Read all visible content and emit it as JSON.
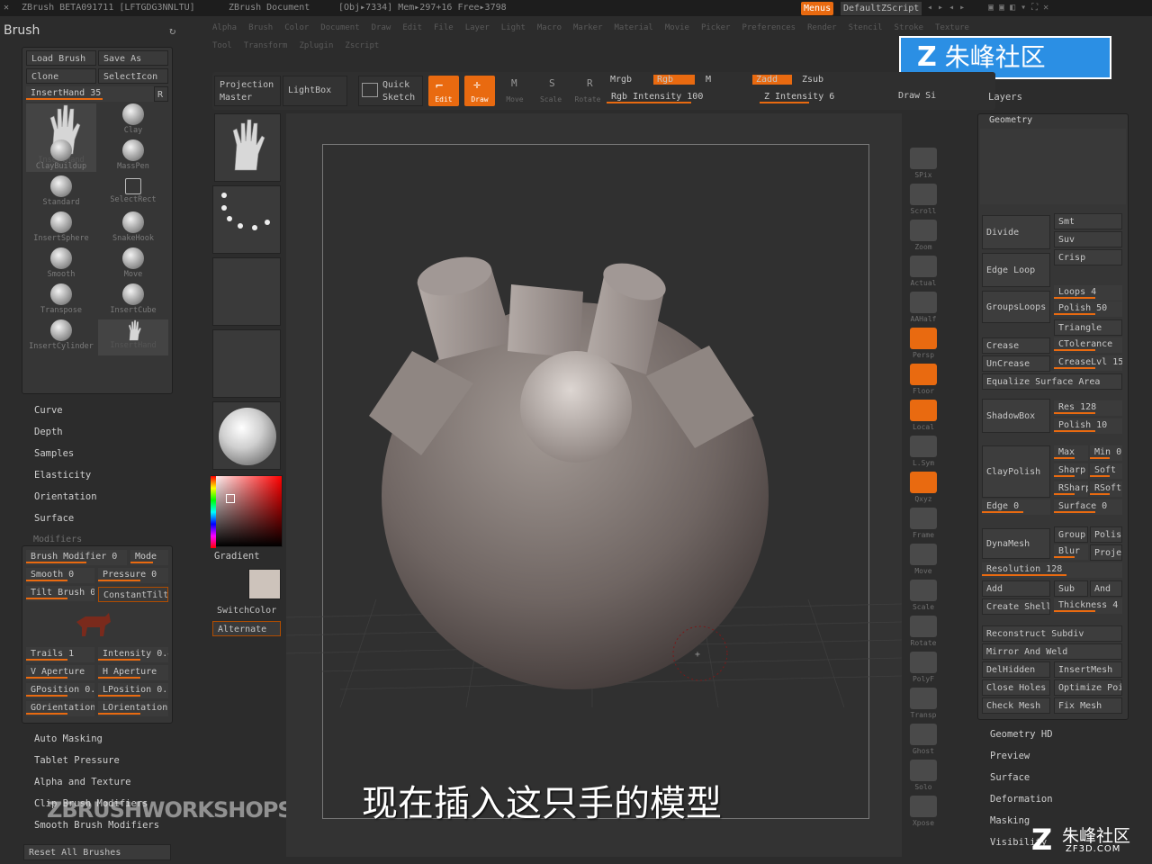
{
  "window": {
    "title": "ZBrush BETA091711 [LFTGDG3NNLTU]",
    "document": "ZBrush Document",
    "stats": "[Obj▸7334] Mem▸297+16 Free▸3798",
    "menus_btn": "Menus",
    "script_btn": "DefaultZScript"
  },
  "menubar": {
    "row1": [
      "Alpha",
      "Brush",
      "Color",
      "Document",
      "Draw",
      "Edit",
      "File",
      "Layer",
      "Light",
      "Macro",
      "Marker",
      "Material",
      "Movie",
      "Picker",
      "Preferences",
      "Render",
      "Stencil",
      "Stroke",
      "Texture"
    ],
    "row2": [
      "Tool",
      "Transform",
      "Zplugin",
      "Zscript"
    ]
  },
  "watermark": {
    "top_text": "朱峰社区",
    "bottom_text": "朱峰社区",
    "bottom_url": "ZF3D.COM",
    "workshops": "ZBRUSHWORKSHOPS"
  },
  "subtitle": "现在插入这只手的模型",
  "brush_panel": {
    "title": "Brush",
    "load": "Load Brush",
    "save": "Save As",
    "clone": "Clone",
    "selecticon": "SelectIcon",
    "current": "InsertHand 35",
    "r_btn": "R",
    "tiles": [
      {
        "label": "InsertHand",
        "shape": "hand"
      },
      {
        "label": "Clay",
        "shape": "sphere"
      },
      {
        "label": "ClayBuildup",
        "shape": "sphere"
      },
      {
        "label": "MassPen",
        "shape": "sphere"
      },
      {
        "label": "Standard",
        "shape": "sphere"
      },
      {
        "label": "SelectRect",
        "shape": "square"
      },
      {
        "label": "InsertSphere",
        "shape": "sphere"
      },
      {
        "label": "SnakeHook",
        "shape": "sphere"
      },
      {
        "label": "Smooth",
        "shape": "sphere"
      },
      {
        "label": "Move",
        "shape": "sphere"
      },
      {
        "label": "Transpose",
        "shape": "sphere"
      },
      {
        "label": "InsertCube",
        "shape": "sphere"
      },
      {
        "label": "InsertCylinder",
        "shape": "sphere"
      },
      {
        "label": "InsertHand",
        "shape": "hand"
      }
    ],
    "sections": [
      "Curve",
      "Depth",
      "Samples",
      "Elasticity",
      "Orientation",
      "Surface"
    ],
    "modifiers_title": "Modifiers",
    "modifiers": {
      "brush_modifier": "Brush Modifier 0",
      "mode": "Mode",
      "smooth": "Smooth 0",
      "pressure": "Pressure 0",
      "tilt": "Tilt Brush 0",
      "constant_tilt": "ConstantTilt",
      "trails": "Trails 1",
      "intensity": "Intensity 0.4",
      "v_aperture": "V Aperture",
      "h_aperture": "H Aperture",
      "gposition": "GPosition 0.2",
      "lposition": "LPosition 0.2",
      "gorientation": "GOrientation",
      "lorientation": "LOrientation"
    },
    "sections2": [
      "Auto Masking",
      "Tablet Pressure",
      "Alpha and Texture",
      "Clip Brush Modifiers",
      "Smooth Brush Modifiers"
    ],
    "reset": "Reset All Brushes"
  },
  "toolbar": {
    "projection_master": "Projection Master",
    "lightbox": "LightBox",
    "quick_sketch": "Quick Sketch",
    "edit": "Edit",
    "draw": "Draw",
    "move": "Move",
    "scale": "Scale",
    "rotate": "Rotate",
    "mrgb": "Mrgb",
    "rgb": "Rgb",
    "m": "M",
    "rgb_intensity": "Rgb Intensity 100",
    "zadd": "Zadd",
    "zsub": "Zsub",
    "z_intensity": "Z Intensity 6",
    "draw_size": "Draw Si"
  },
  "left_shelf": {
    "gradient": "Gradient",
    "switchcolor": "SwitchColor",
    "alternate": "Alternate"
  },
  "right_tools": [
    "SPix",
    "Scroll",
    "Zoom",
    "Actual",
    "AAHalf",
    "Persp",
    "Floor",
    "Local",
    "L.Sym",
    "Qxyz",
    "Frame",
    "Move",
    "Scale",
    "Rotate",
    "PolyF",
    "Transp",
    "Ghost",
    "Solo",
    "Xpose"
  ],
  "right_panel": {
    "layers": "Layers",
    "geometry": "Geometry",
    "divide": "Divide",
    "smt": "Smt",
    "suv": "Suv",
    "edge_loop": "Edge Loop",
    "crisp": "Crisp",
    "groups_loops": "GroupsLoops",
    "loops": "Loops 4",
    "polish": "Polish 50",
    "triangle": "Triangle",
    "crease": "Crease",
    "ctolerance": "CTolerance",
    "uncrease": "UnCrease",
    "creaselvl": "CreaseLvl 15",
    "equalize": "Equalize Surface Area",
    "shadowbox": "ShadowBox",
    "res": "Res 128",
    "polish10": "Polish 10",
    "claypolish": "ClayPolish",
    "max": "Max",
    "min": "Min 0",
    "sharp": "Sharp",
    "soft": "Soft",
    "rsharp": "RSharp",
    "rsoft": "RSoft",
    "edge": "Edge 0",
    "surface": "Surface 0",
    "dynamesh": "DynaMesh",
    "group": "Group",
    "polish2": "Polish",
    "blur": "Blur",
    "project": "Projec",
    "resolution": "Resolution 128",
    "add": "Add",
    "sub": "Sub",
    "and": "And",
    "create_shell": "Create Shell",
    "thickness": "Thickness 4",
    "reconstruct": "Reconstruct Subdiv",
    "mirror_weld": "Mirror And Weld",
    "delhidden": "DelHidden",
    "insertmesh": "InsertMesh",
    "close_holes": "Close Holes",
    "optimize": "Optimize Poi",
    "check_mesh": "Check Mesh",
    "fix_mesh": "Fix Mesh",
    "sections": [
      "Geometry HD",
      "Preview",
      "Surface",
      "Deformation",
      "Masking",
      "Visibility"
    ]
  },
  "colors": {
    "accent": "#e96a10",
    "bg": "#2c2c2c",
    "panel": "#363636"
  }
}
